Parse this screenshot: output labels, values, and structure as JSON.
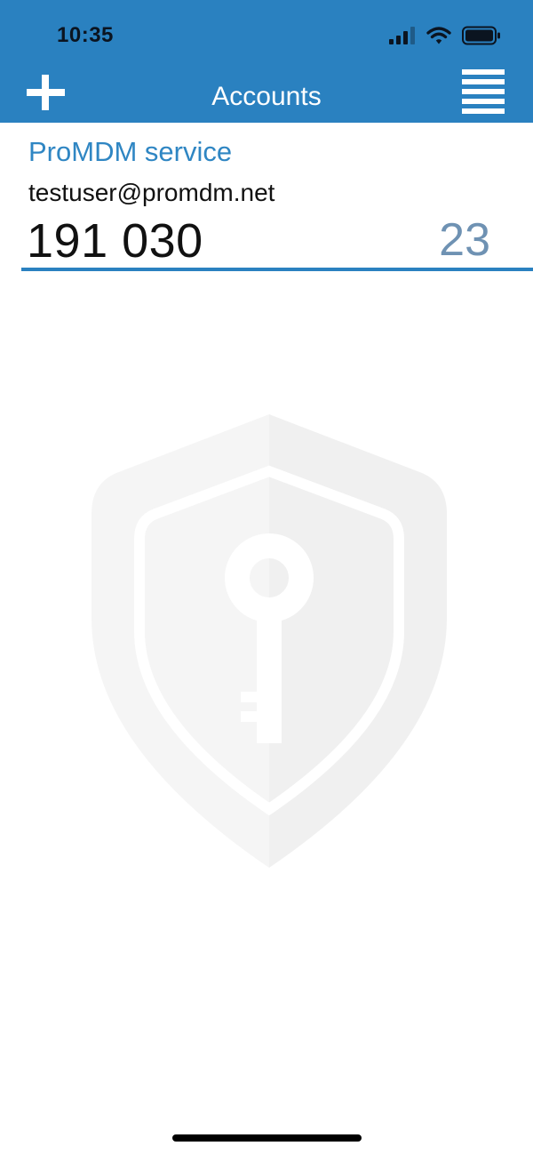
{
  "status_bar": {
    "time": "10:35",
    "icons": [
      "cellular-signal-icon",
      "wifi-icon",
      "battery-icon"
    ]
  },
  "header": {
    "title": "Accounts",
    "add_icon": "plus-icon",
    "menu_icon": "menu-icon",
    "background_color": "#2a81c0"
  },
  "accounts": [
    {
      "service": "ProMDM service",
      "user": "testuser@promdm.net",
      "code": "191 030",
      "seconds_remaining": "23"
    }
  ],
  "watermark": {
    "icon": "shield-key-icon"
  },
  "colors": {
    "accent": "#2a81c0",
    "service_text": "#2f86c3",
    "timer_text": "#6f92b3"
  }
}
